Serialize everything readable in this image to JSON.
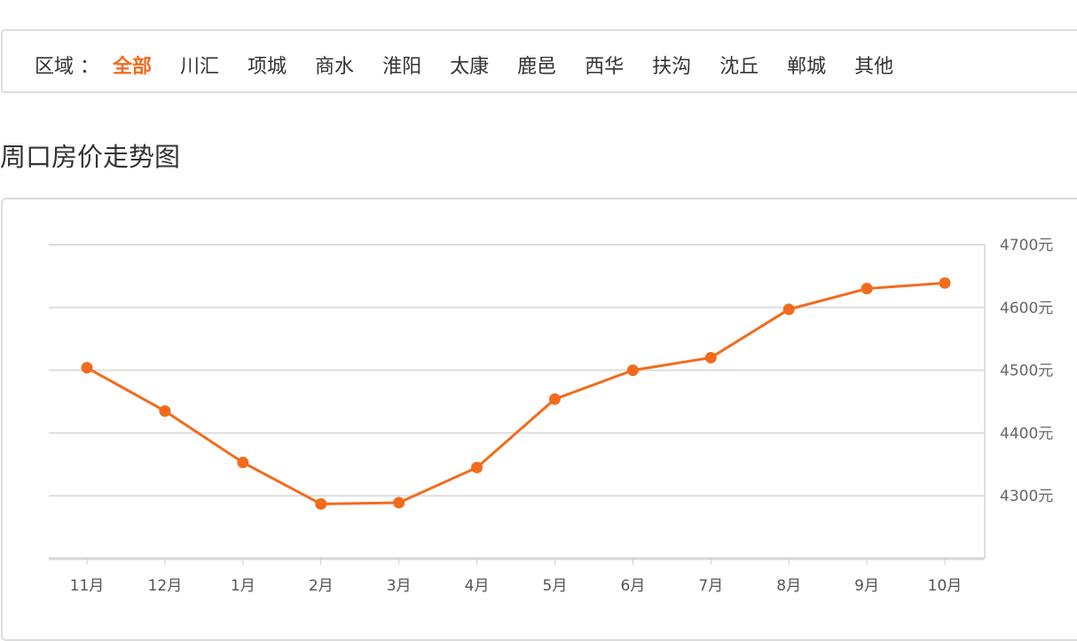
{
  "filter": {
    "label": "区域 ：",
    "options": [
      {
        "label": "全部",
        "active": true
      },
      {
        "label": "川汇",
        "active": false
      },
      {
        "label": "项城",
        "active": false
      },
      {
        "label": "商水",
        "active": false
      },
      {
        "label": "淮阳",
        "active": false
      },
      {
        "label": "太康",
        "active": false
      },
      {
        "label": "鹿邑",
        "active": false
      },
      {
        "label": "西华",
        "active": false
      },
      {
        "label": "扶沟",
        "active": false
      },
      {
        "label": "沈丘",
        "active": false
      },
      {
        "label": "郸城",
        "active": false
      },
      {
        "label": "其他",
        "active": false
      }
    ],
    "active_color": "#f26b1d"
  },
  "section_title": "周口房价走势图",
  "chart_data": {
    "type": "line",
    "title": "周口房价走势图",
    "xlabel": "",
    "ylabel": "",
    "categories": [
      "11月",
      "12月",
      "1月",
      "2月",
      "3月",
      "4月",
      "5月",
      "6月",
      "7月",
      "8月",
      "9月",
      "10月"
    ],
    "series": [
      {
        "name": "周口房价",
        "color": "#f26b1d",
        "values": [
          4504,
          4435,
          4353,
          4287,
          4289,
          4345,
          4454,
          4500,
          4520,
          4597,
          4630,
          4639
        ]
      }
    ],
    "ylim": [
      4200,
      4700
    ],
    "yticks": [
      4300,
      4400,
      4500,
      4600,
      4700
    ],
    "ytick_labels": [
      "4300元",
      "4400元",
      "4500元",
      "4600元",
      "4700元"
    ],
    "y_axis_position": "right",
    "grid": true,
    "legend": "none"
  }
}
